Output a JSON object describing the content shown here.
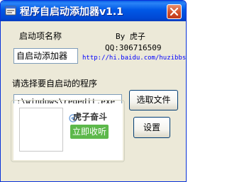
{
  "window": {
    "title": "程序自启动添加器v1.1",
    "titlebar_color": "#0058e6",
    "close_color": "#d2502a"
  },
  "icons": {
    "app": "app-icon",
    "close": "close-icon",
    "audio": "headphone-icon"
  },
  "form": {
    "item_name_label": "启动项名称",
    "item_name_value": "自启动添加器",
    "program_label": "请选择要自启动的程序",
    "program_path_value": ":\\windows\\regedit.exe",
    "browse_button": "选取文件",
    "settings_button": "设置"
  },
  "credits": {
    "author": "By 虎子",
    "qq": "QQ:306716509",
    "url": "http://hi.baidu.com/huzibbs"
  },
  "ad": {
    "title": "虎子奋斗",
    "listen_button": "立即收听",
    "listen_color": "#5db84b"
  }
}
